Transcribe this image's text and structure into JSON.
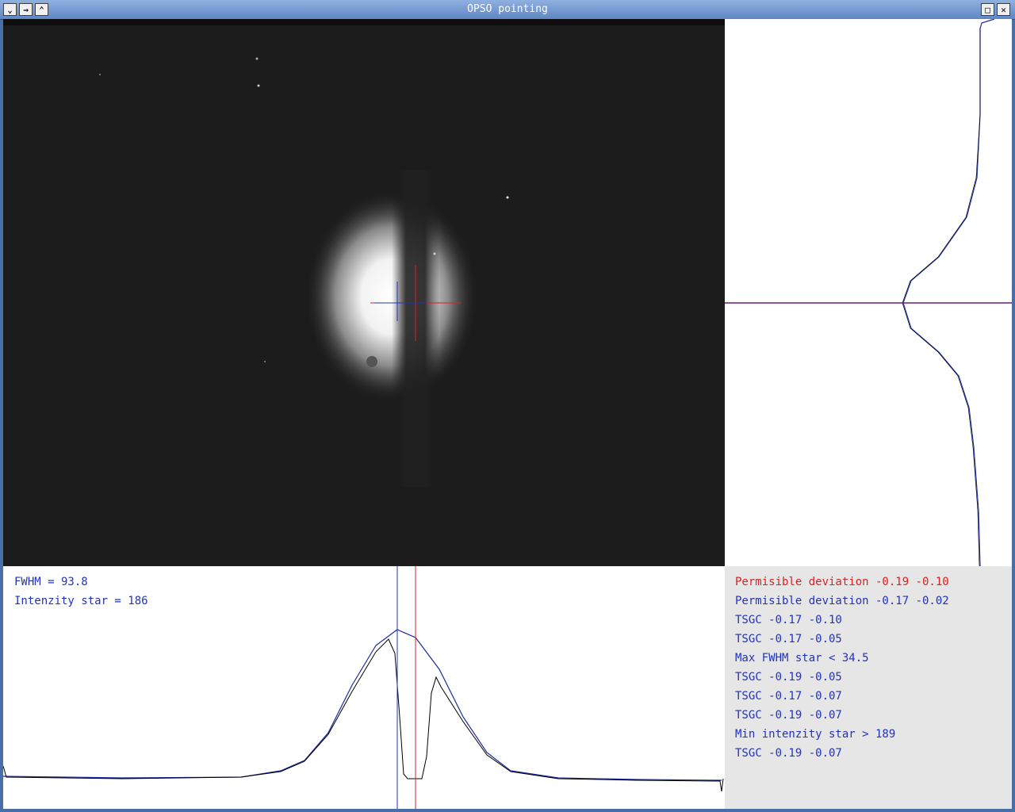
{
  "window": {
    "title": "OPSO pointing",
    "controls_left": [
      "menu-icon",
      "pin-icon",
      "shade-icon"
    ],
    "controls_right": [
      "maximize-icon",
      "close-icon"
    ]
  },
  "stats": {
    "fwhm": "FWHM = 93.8",
    "intensity": "Intenzity star = 186"
  },
  "log": [
    {
      "text": "Permisible deviation -0.19 -0.10",
      "level": "warn"
    },
    {
      "text": "Permisible deviation -0.17 -0.02",
      "level": "info"
    },
    {
      "text": "TSGC -0.17 -0.10",
      "level": "info"
    },
    {
      "text": "TSGC -0.17 -0.05",
      "level": "info"
    },
    {
      "text": "Max FWHM star < 34.5",
      "level": "info"
    },
    {
      "text": "TSGC -0.19 -0.05",
      "level": "info"
    },
    {
      "text": "TSGC -0.17 -0.07",
      "level": "info"
    },
    {
      "text": "TSGC -0.19 -0.07",
      "level": "info"
    },
    {
      "text": "Min intenzity star > 189",
      "level": "info"
    },
    {
      "text": "TSGC -0.19 -0.07",
      "level": "info"
    }
  ],
  "colors": {
    "target_crosshair": "#dd2020",
    "centroid_crosshair": "#2233bb",
    "profile_line": "#000000",
    "fit_line": "#1a2aa0",
    "warn_text": "#dd2020",
    "info_text": "#2233bb"
  }
}
